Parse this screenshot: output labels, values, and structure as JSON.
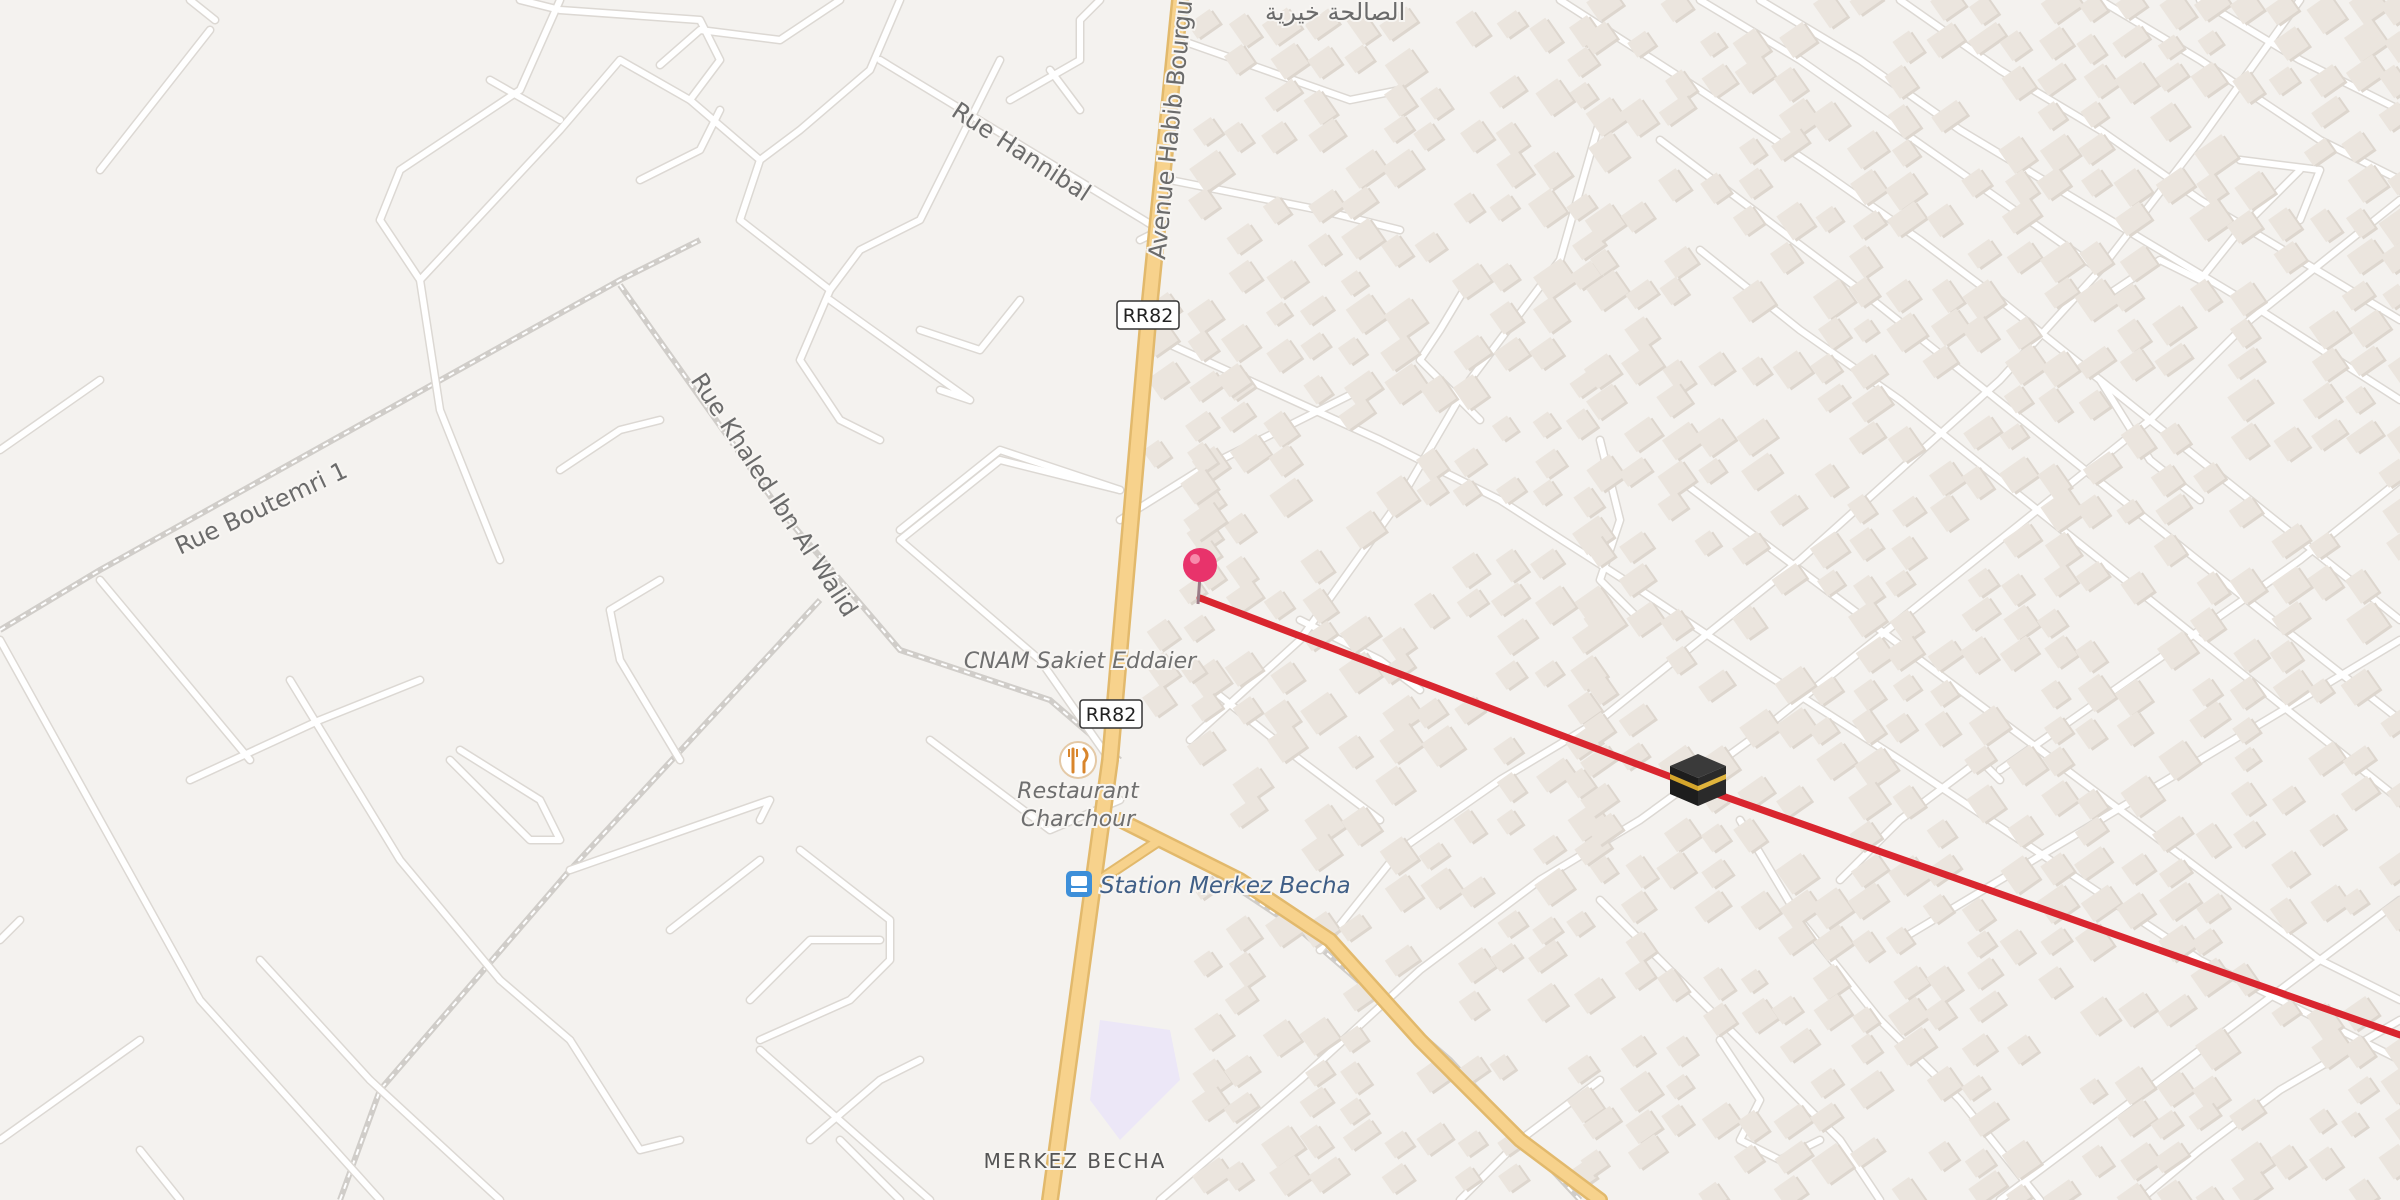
{
  "map": {
    "street_labels": {
      "avenue": "Avenue Habib Bourgui",
      "hannibal": "Rue Hannibal",
      "boutemri": "Rue Boutemri 1",
      "khaled": "Rue Khaled Ibn Al Walid"
    },
    "arabic_label": "الصالحة خيرية",
    "route_shields": [
      "RR82",
      "RR82"
    ],
    "pois": {
      "cnam": "CNAM Sakiet Eddaier",
      "restaurant_line1": "Restaurant",
      "restaurant_line2": "Charchour",
      "station": "Station Merkez Becha"
    },
    "place_name": "MERKEZ BECHA",
    "icons": {
      "pin": "location-pin-icon",
      "restaurant": "fork-knife-icon",
      "bus": "bus-stop-icon",
      "kaaba": "kaaba-icon"
    },
    "colors": {
      "background": "#f4f2ef",
      "minor_road": "#ffffff",
      "major_road": "#f7d28c",
      "major_road_casing": "#e2b96c",
      "building": "#ebe5de",
      "route_line": "#d9262f",
      "pin": "#e8336b",
      "landuse": "#ece7f7"
    }
  }
}
